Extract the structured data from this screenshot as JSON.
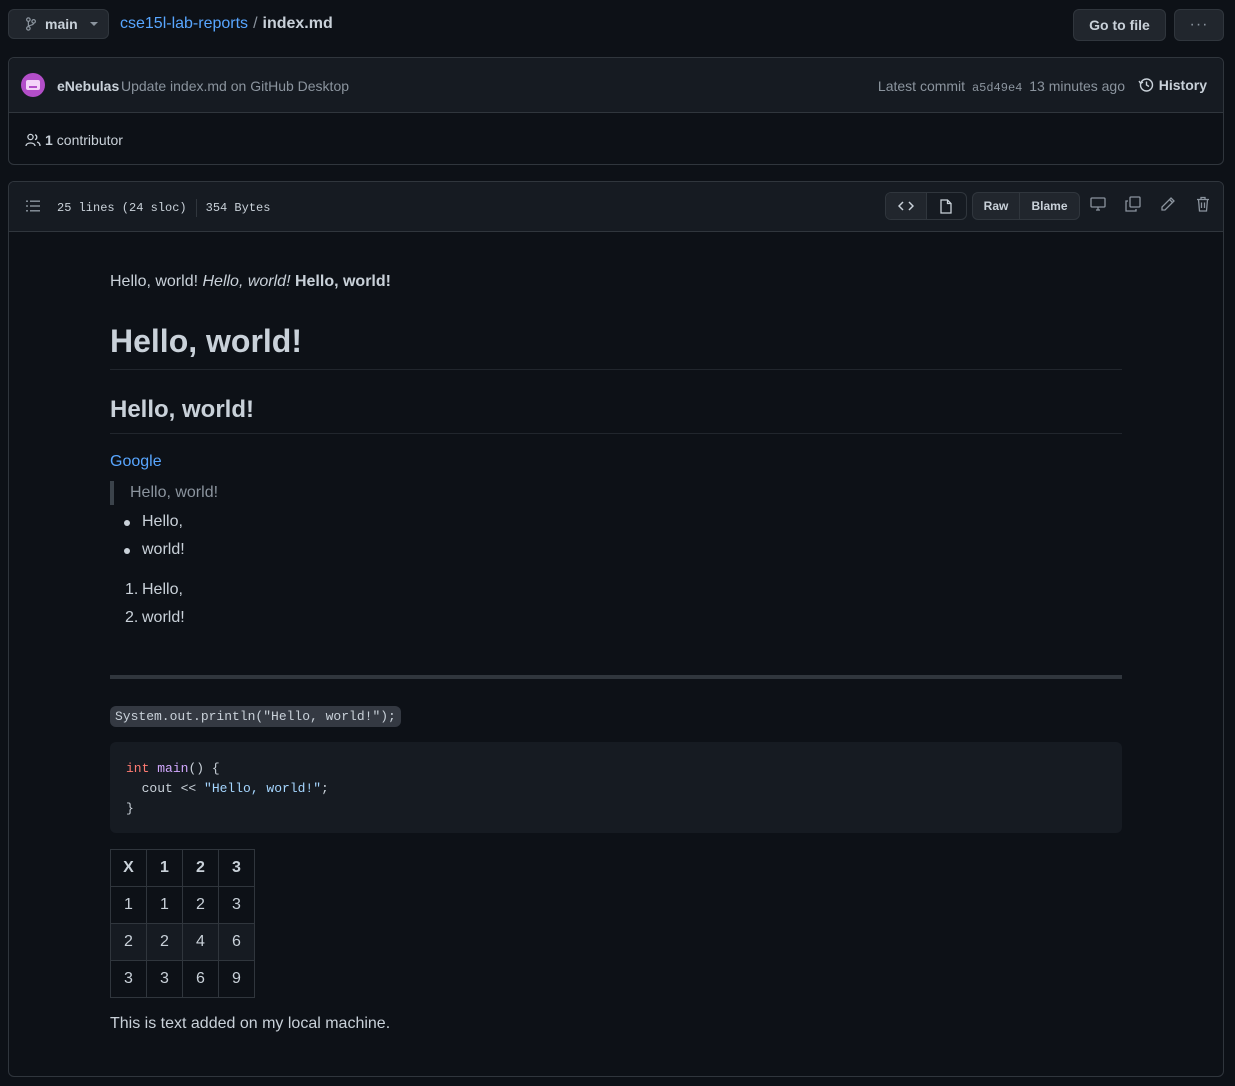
{
  "topbar": {
    "branch": "main",
    "repo": "cse15l-lab-reports",
    "separator": "/",
    "file": "index.md",
    "goto_label": "Go to file",
    "more_label": "···"
  },
  "commit": {
    "author": "eNebulas",
    "message": "Update index.md on GitHub Desktop",
    "latest_label": "Latest commit",
    "sha": "a5d49e4",
    "time": "13 minutes ago",
    "history_label": "History",
    "contributors_count": "1",
    "contributors_label": "contributor"
  },
  "file_header": {
    "lines": "25 lines (24 sloc)",
    "size": "354 Bytes",
    "raw_label": "Raw",
    "blame_label": "Blame"
  },
  "markdown": {
    "p1_plain": "Hello, world!",
    "p1_italic": "Hello, world!",
    "p1_bold": "Hello, world!",
    "h1": "Hello, world!",
    "h2": "Hello, world!",
    "link": "Google",
    "quote": "Hello, world!",
    "bullets": [
      "Hello,",
      "world!"
    ],
    "ordered": [
      "Hello,",
      "world!"
    ],
    "inline_code": "System.out.println(\"Hello, world!\");",
    "code_block": {
      "kw": "int",
      "fn": "main",
      "sig_rest": "() {",
      "line2_pre": "  cout << ",
      "line2_str": "\"Hello, world!\"",
      "line2_post": ";",
      "line3": "}"
    },
    "table": {
      "header": [
        "X",
        "1",
        "2",
        "3"
      ],
      "rows": [
        [
          "1",
          "1",
          "2",
          "3"
        ],
        [
          "2",
          "2",
          "4",
          "6"
        ],
        [
          "3",
          "3",
          "6",
          "9"
        ]
      ]
    },
    "last_paragraph": "This is text added on my local machine."
  }
}
